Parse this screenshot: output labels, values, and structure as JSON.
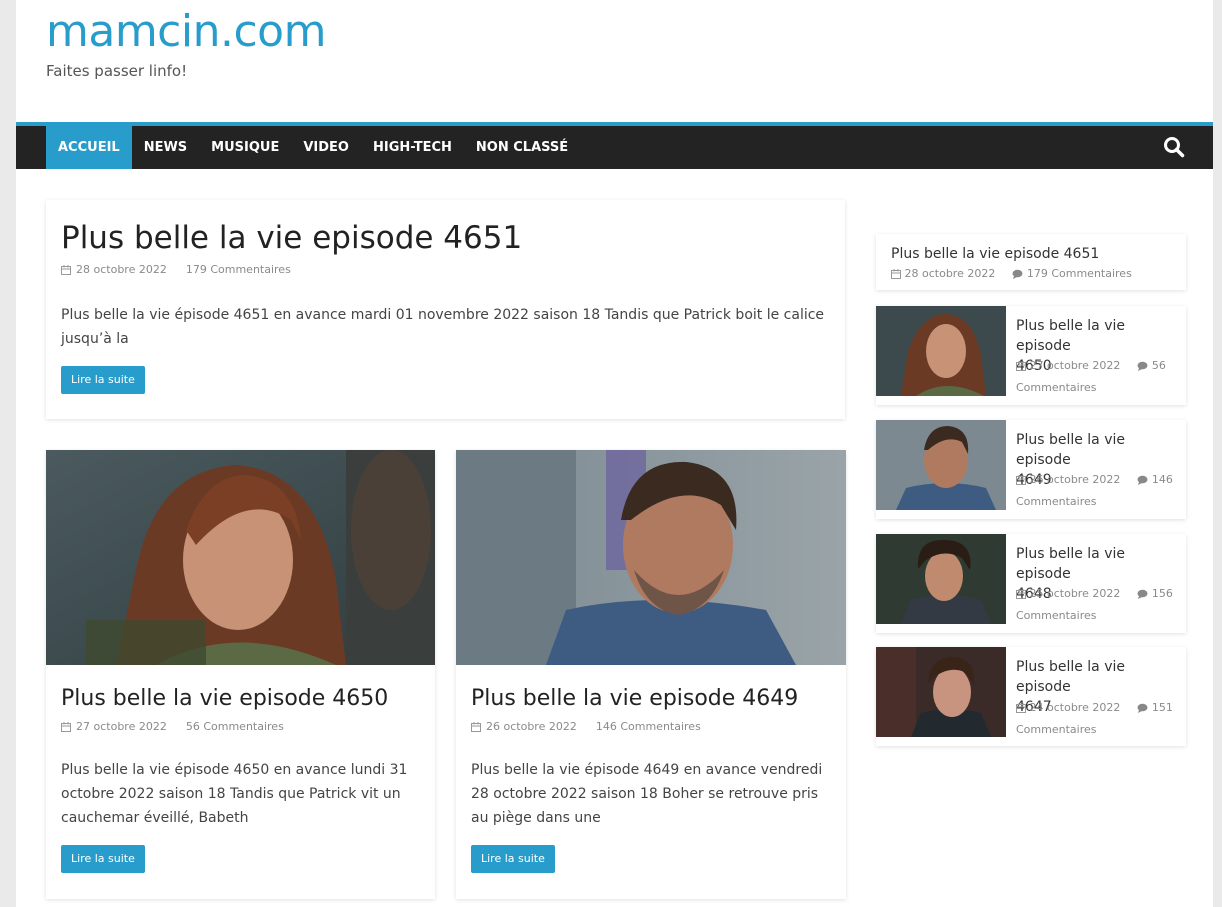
{
  "site": {
    "title": "mamcin.com",
    "tagline": "Faites passer linfo!"
  },
  "nav": {
    "items": [
      "ACCUEIL",
      "NEWS",
      "MUSIQUE",
      "VIDEO",
      "HIGH-TECH",
      "NON CLASSÉ"
    ],
    "active": "ACCUEIL"
  },
  "colors": {
    "accent": "#289dcc",
    "nav_bg": "#232323"
  },
  "featured": {
    "title": "Plus belle la vie episode 4651",
    "date": "28 octobre 2022",
    "comments": "179 Commentaires",
    "excerpt": "Plus belle la vie épisode 4651 en avance mardi 01 novembre 2022 saison 18 Tandis que Patrick boit le calice jusqu’à la",
    "read_more": "Lire la suite"
  },
  "posts": [
    {
      "title": "Plus belle la vie episode 4650",
      "date": "27 octobre 2022",
      "comments": "56 Commentaires",
      "excerpt": "Plus belle la vie épisode 4650 en avance lundi 31 octobre 2022 saison 18 Tandis que Patrick vit un cauchemar éveillé, Babeth",
      "read_more": "Lire la suite"
    },
    {
      "title": "Plus belle la vie episode 4649",
      "date": "26 octobre 2022",
      "comments": "146 Commentaires",
      "excerpt": "Plus belle la vie épisode 4649 en avance vendredi 28 octobre 2022 saison 18 Boher se retrouve pris au piège dans une",
      "read_more": "Lire la suite"
    }
  ],
  "sidebar": {
    "top": {
      "title": "Plus belle la vie episode 4651",
      "date": "28 octobre 2022",
      "comments": "179 Commentaires"
    },
    "items": [
      {
        "title_line1": "Plus belle la vie episode",
        "title_line2": "4650",
        "date": "27 octobre 2022",
        "comments_count": "56",
        "comments_word": "Commentaires"
      },
      {
        "title_line1": "Plus belle la vie episode",
        "title_line2": "4649",
        "date": "26 octobre 2022",
        "comments_count": "146",
        "comments_word": "Commentaires"
      },
      {
        "title_line1": "Plus belle la vie episode",
        "title_line2": "4648",
        "date": "25 octobre 2022",
        "comments_count": "156",
        "comments_word": "Commentaires"
      },
      {
        "title_line1": "Plus belle la vie episode",
        "title_line2": "4647",
        "date": "24 octobre 2022",
        "comments_count": "151",
        "comments_word": "Commentaires"
      }
    ]
  }
}
